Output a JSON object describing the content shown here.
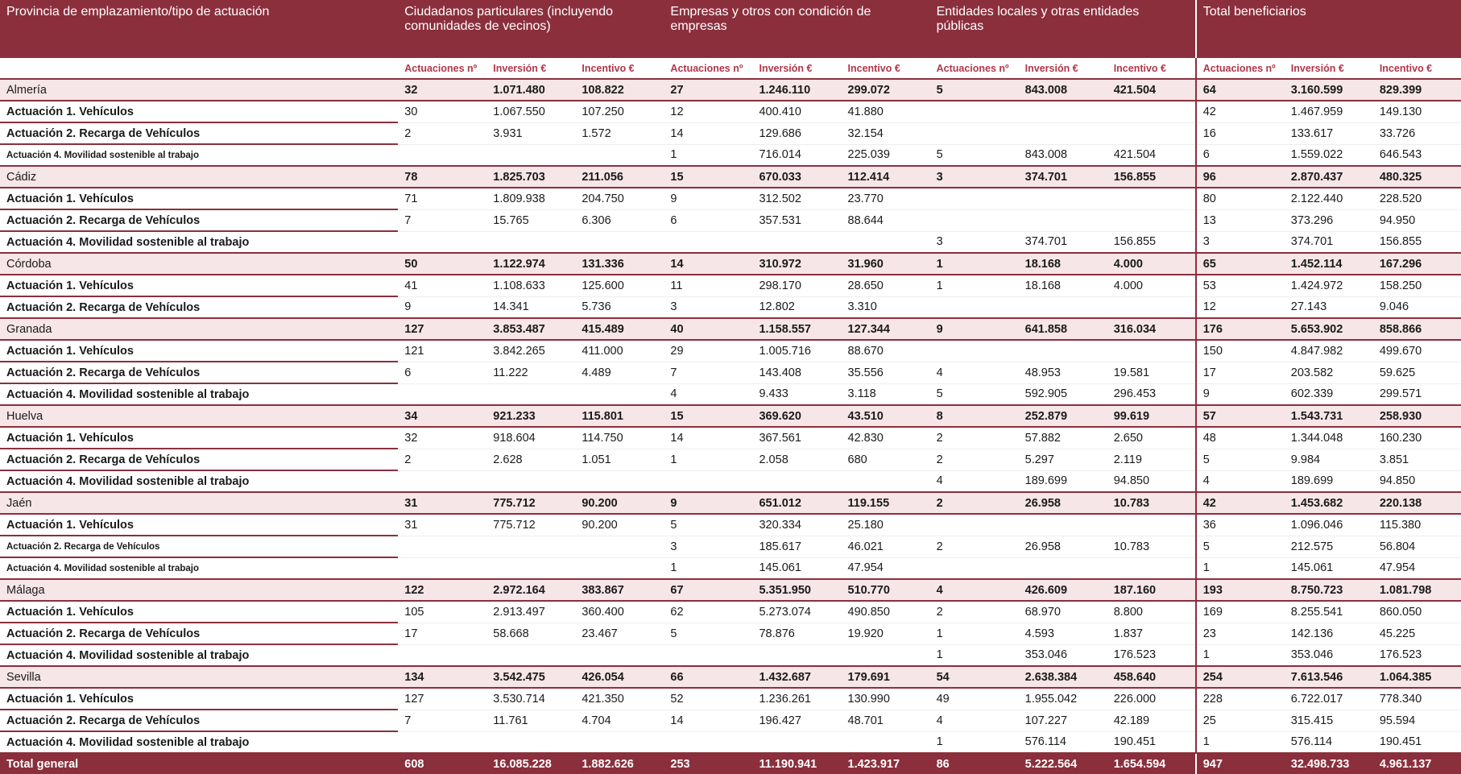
{
  "header": {
    "col0": "Provincia de emplazamiento/tipo de actuación",
    "groups": [
      "Ciudadanos particulares (incluyendo comunidades de vecinos)",
      "Empresas y otros con condición de empresas",
      "Entidades locales y otras entidades públicas",
      "Total beneficiarios"
    ],
    "subheaders": [
      "Actuaciones nº",
      "Inversión €",
      "Incentivo €"
    ]
  },
  "rows": [
    {
      "type": "prov",
      "label": "Almería",
      "v": [
        "32",
        "1.071.480",
        "108.822",
        "27",
        "1.246.110",
        "299.072",
        "5",
        "843.008",
        "421.504",
        "64",
        "3.160.599",
        "829.399"
      ]
    },
    {
      "type": "sub",
      "label": "Actuación 1. Vehículos",
      "v": [
        "30",
        "1.067.550",
        "107.250",
        "12",
        "400.410",
        "41.880",
        "",
        "",
        "",
        "42",
        "1.467.959",
        "149.130"
      ]
    },
    {
      "type": "sub",
      "label": "Actuación 2. Recarga de Vehículos",
      "v": [
        "2",
        "3.931",
        "1.572",
        "14",
        "129.686",
        "32.154",
        "",
        "",
        "",
        "16",
        "133.617",
        "33.726"
      ]
    },
    {
      "type": "sub",
      "small": true,
      "last": true,
      "label": "Actuación 4. Movilidad sostenible al trabajo",
      "v": [
        "",
        "",
        "",
        "1",
        "716.014",
        "225.039",
        "5",
        "843.008",
        "421.504",
        "6",
        "1.559.022",
        "646.543"
      ]
    },
    {
      "type": "prov",
      "label": "Cádiz",
      "v": [
        "78",
        "1.825.703",
        "211.056",
        "15",
        "670.033",
        "112.414",
        "3",
        "374.701",
        "156.855",
        "96",
        "2.870.437",
        "480.325"
      ]
    },
    {
      "type": "sub",
      "label": "Actuación 1. Vehículos",
      "v": [
        "71",
        "1.809.938",
        "204.750",
        "9",
        "312.502",
        "23.770",
        "",
        "",
        "",
        "80",
        "2.122.440",
        "228.520"
      ]
    },
    {
      "type": "sub",
      "label": "Actuación 2. Recarga de Vehículos",
      "v": [
        "7",
        "15.765",
        "6.306",
        "6",
        "357.531",
        "88.644",
        "",
        "",
        "",
        "13",
        "373.296",
        "94.950"
      ]
    },
    {
      "type": "sub",
      "last": true,
      "label": "Actuación 4. Movilidad sostenible al trabajo",
      "v": [
        "",
        "",
        "",
        "",
        "",
        "",
        "3",
        "374.701",
        "156.855",
        "3",
        "374.701",
        "156.855"
      ]
    },
    {
      "type": "prov",
      "label": "Córdoba",
      "v": [
        "50",
        "1.122.974",
        "131.336",
        "14",
        "310.972",
        "31.960",
        "1",
        "18.168",
        "4.000",
        "65",
        "1.452.114",
        "167.296"
      ]
    },
    {
      "type": "sub",
      "label": "Actuación 1. Vehículos",
      "v": [
        "41",
        "1.108.633",
        "125.600",
        "11",
        "298.170",
        "28.650",
        "1",
        "18.168",
        "4.000",
        "53",
        "1.424.972",
        "158.250"
      ]
    },
    {
      "type": "sub",
      "last": true,
      "label": "Actuación 2. Recarga de Vehículos",
      "v": [
        "9",
        "14.341",
        "5.736",
        "3",
        "12.802",
        "3.310",
        "",
        "",
        "",
        "12",
        "27.143",
        "9.046"
      ]
    },
    {
      "type": "prov",
      "label": "Granada",
      "v": [
        "127",
        "3.853.487",
        "415.489",
        "40",
        "1.158.557",
        "127.344",
        "9",
        "641.858",
        "316.034",
        "176",
        "5.653.902",
        "858.866"
      ]
    },
    {
      "type": "sub",
      "label": "Actuación 1. Vehículos",
      "v": [
        "121",
        "3.842.265",
        "411.000",
        "29",
        "1.005.716",
        "88.670",
        "",
        "",
        "",
        "150",
        "4.847.982",
        "499.670"
      ]
    },
    {
      "type": "sub",
      "label": "Actuación 2. Recarga de Vehículos",
      "v": [
        "6",
        "11.222",
        "4.489",
        "7",
        "143.408",
        "35.556",
        "4",
        "48.953",
        "19.581",
        "17",
        "203.582",
        "59.625"
      ]
    },
    {
      "type": "sub",
      "last": true,
      "label": "Actuación 4. Movilidad sostenible al trabajo",
      "v": [
        "",
        "",
        "",
        "4",
        "9.433",
        "3.118",
        "5",
        "592.905",
        "296.453",
        "9",
        "602.339",
        "299.571"
      ]
    },
    {
      "type": "prov",
      "label": "Huelva",
      "v": [
        "34",
        "921.233",
        "115.801",
        "15",
        "369.620",
        "43.510",
        "8",
        "252.879",
        "99.619",
        "57",
        "1.543.731",
        "258.930"
      ]
    },
    {
      "type": "sub",
      "label": "Actuación 1. Vehículos",
      "v": [
        "32",
        "918.604",
        "114.750",
        "14",
        "367.561",
        "42.830",
        "2",
        "57.882",
        "2.650",
        "48",
        "1.344.048",
        "160.230"
      ]
    },
    {
      "type": "sub",
      "label": "Actuación 2. Recarga de Vehículos",
      "v": [
        "2",
        "2.628",
        "1.051",
        "1",
        "2.058",
        "680",
        "2",
        "5.297",
        "2.119",
        "5",
        "9.984",
        "3.851"
      ]
    },
    {
      "type": "sub",
      "last": true,
      "label": "Actuación 4. Movilidad sostenible al trabajo",
      "v": [
        "",
        "",
        "",
        "",
        "",
        "",
        "4",
        "189.699",
        "94.850",
        "4",
        "189.699",
        "94.850"
      ]
    },
    {
      "type": "prov",
      "label": "Jaén",
      "v": [
        "31",
        "775.712",
        "90.200",
        "9",
        "651.012",
        "119.155",
        "2",
        "26.958",
        "10.783",
        "42",
        "1.453.682",
        "220.138"
      ]
    },
    {
      "type": "sub",
      "label": "Actuación 1. Vehículos",
      "v": [
        "31",
        "775.712",
        "90.200",
        "5",
        "320.334",
        "25.180",
        "",
        "",
        "",
        "36",
        "1.096.046",
        "115.380"
      ]
    },
    {
      "type": "sub",
      "small": true,
      "label": "Actuación 2. Recarga de Vehículos",
      "v": [
        "",
        "",
        "",
        "3",
        "185.617",
        "46.021",
        "2",
        "26.958",
        "10.783",
        "5",
        "212.575",
        "56.804"
      ]
    },
    {
      "type": "sub",
      "small": true,
      "last": true,
      "label": "Actuación 4. Movilidad sostenible al trabajo",
      "v": [
        "",
        "",
        "",
        "1",
        "145.061",
        "47.954",
        "",
        "",
        "",
        "1",
        "145.061",
        "47.954"
      ]
    },
    {
      "type": "prov",
      "label": "Málaga",
      "v": [
        "122",
        "2.972.164",
        "383.867",
        "67",
        "5.351.950",
        "510.770",
        "4",
        "426.609",
        "187.160",
        "193",
        "8.750.723",
        "1.081.798"
      ]
    },
    {
      "type": "sub",
      "label": "Actuación 1. Vehículos",
      "v": [
        "105",
        "2.913.497",
        "360.400",
        "62",
        "5.273.074",
        "490.850",
        "2",
        "68.970",
        "8.800",
        "169",
        "8.255.541",
        "860.050"
      ]
    },
    {
      "type": "sub",
      "label": "Actuación 2. Recarga de Vehículos",
      "v": [
        "17",
        "58.668",
        "23.467",
        "5",
        "78.876",
        "19.920",
        "1",
        "4.593",
        "1.837",
        "23",
        "142.136",
        "45.225"
      ]
    },
    {
      "type": "sub",
      "last": true,
      "label": "Actuación 4. Movilidad sostenible al trabajo",
      "v": [
        "",
        "",
        "",
        "",
        "",
        "",
        "1",
        "353.046",
        "176.523",
        "1",
        "353.046",
        "176.523"
      ]
    },
    {
      "type": "prov",
      "label": "Sevilla",
      "v": [
        "134",
        "3.542.475",
        "426.054",
        "66",
        "1.432.687",
        "179.691",
        "54",
        "2.638.384",
        "458.640",
        "254",
        "7.613.546",
        "1.064.385"
      ]
    },
    {
      "type": "sub",
      "label": "Actuación 1. Vehículos",
      "v": [
        "127",
        "3.530.714",
        "421.350",
        "52",
        "1.236.261",
        "130.990",
        "49",
        "1.955.042",
        "226.000",
        "228",
        "6.722.017",
        "778.340"
      ]
    },
    {
      "type": "sub",
      "label": "Actuación 2. Recarga de Vehículos",
      "v": [
        "7",
        "11.761",
        "4.704",
        "14",
        "196.427",
        "48.701",
        "4",
        "107.227",
        "42.189",
        "25",
        "315.415",
        "95.594"
      ]
    },
    {
      "type": "sub",
      "last": true,
      "label": "Actuación 4. Movilidad sostenible al trabajo",
      "v": [
        "",
        "",
        "",
        "",
        "",
        "",
        "1",
        "576.114",
        "190.451",
        "1",
        "576.114",
        "190.451"
      ]
    },
    {
      "type": "total",
      "label": "Total general",
      "v": [
        "608",
        "16.085.228",
        "1.882.626",
        "253",
        "11.190.941",
        "1.423.917",
        "86",
        "5.222.564",
        "1.654.594",
        "947",
        "32.498.733",
        "4.961.137"
      ]
    }
  ]
}
